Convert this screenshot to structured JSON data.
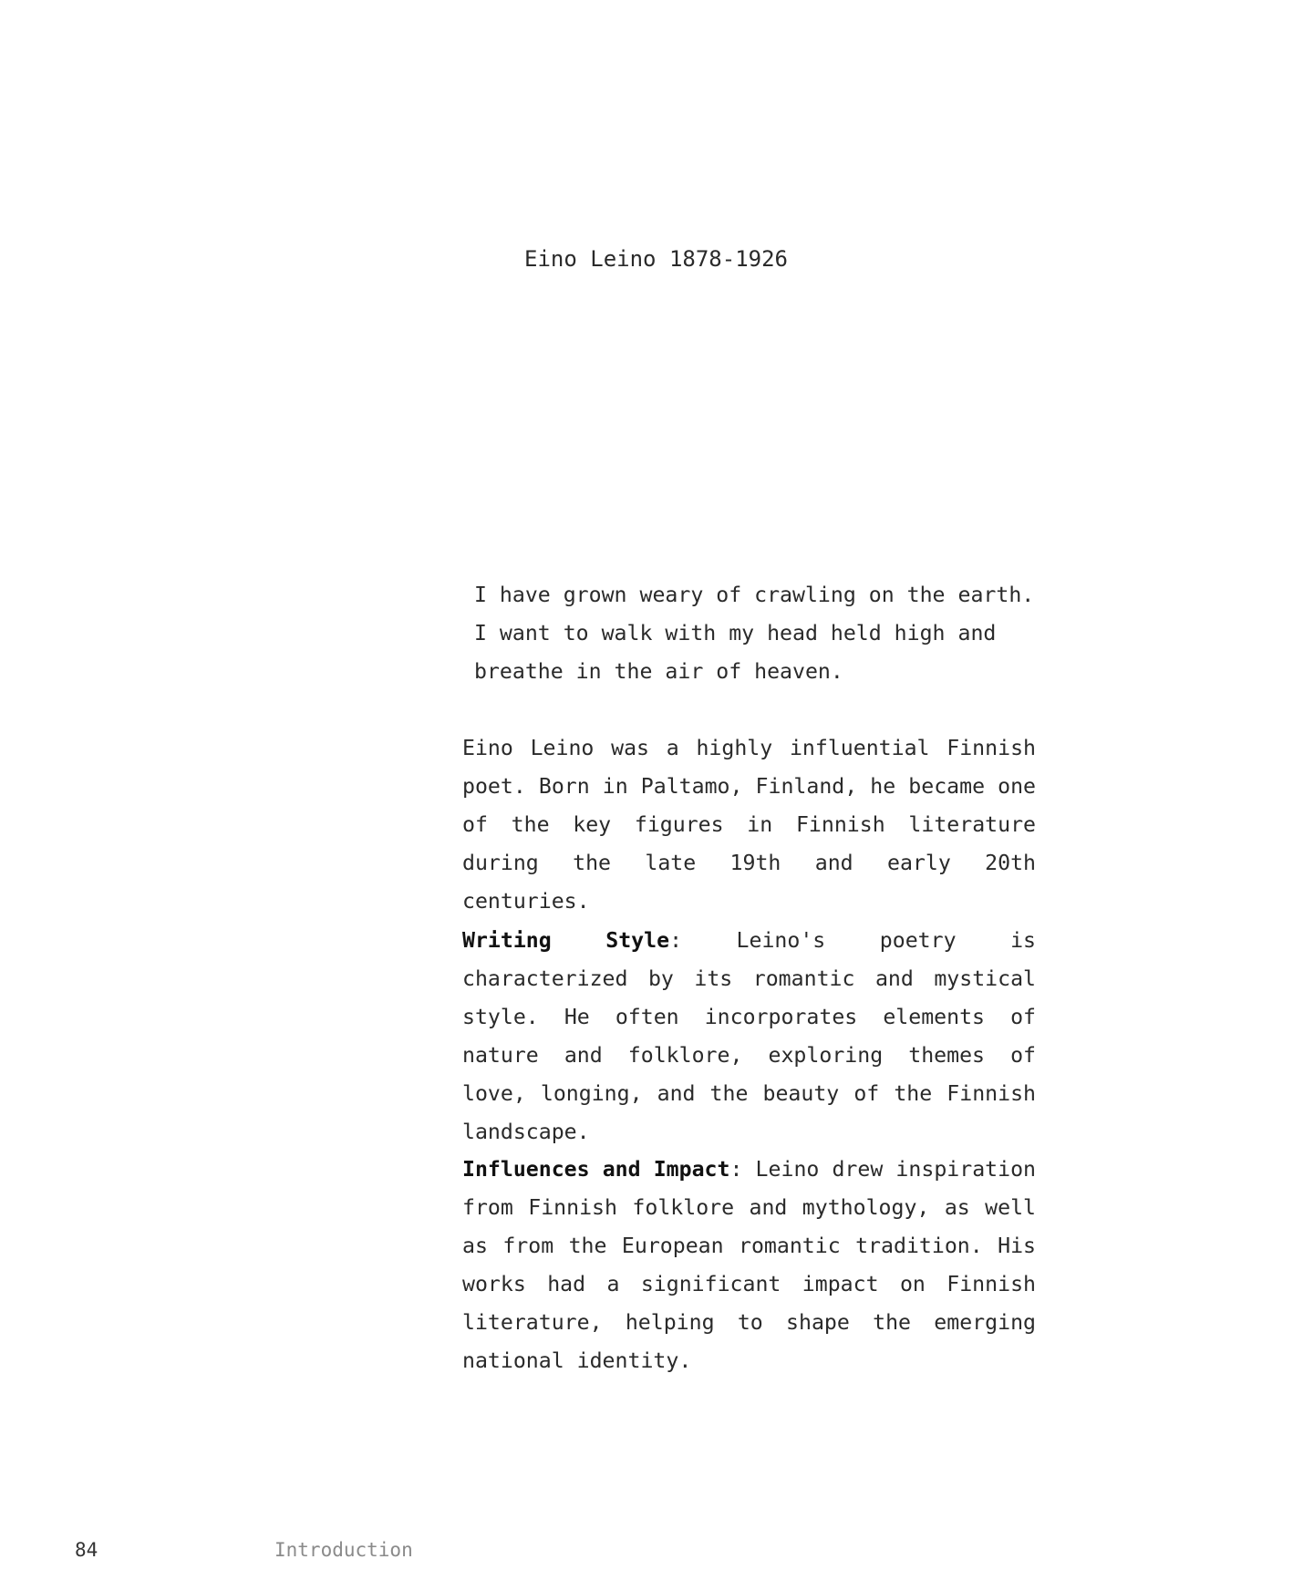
{
  "header": {
    "title": "Eino Leino 1878-1926"
  },
  "quote": {
    "text": "I have grown weary of crawling on the earth. I want to walk with my head held high and breathe in the air of heaven."
  },
  "body": {
    "intro": "Eino Leino was a highly influential Finnish poet. Born in Paltamo, Finland, he became one of the key figures in Finnish literature during the late 19th and early 20th centuries.",
    "writing_style": {
      "heading": "Writing Style",
      "text": ": Leino's poetry is characterized by its romantic and mystical style. He often incorporates elements of nature and folklore, exploring themes of love, longing, and the beauty of the Finnish landscape."
    },
    "influences": {
      "heading": "Influences and Impact",
      "text": ": Leino drew inspiration from Finnish folklore and mythology, as well as from the European romantic tradition. His works had a significant impact on Finnish literature, helping to shape the emerging national identity."
    }
  },
  "footer": {
    "page_number": "84",
    "section": "Introduction"
  }
}
